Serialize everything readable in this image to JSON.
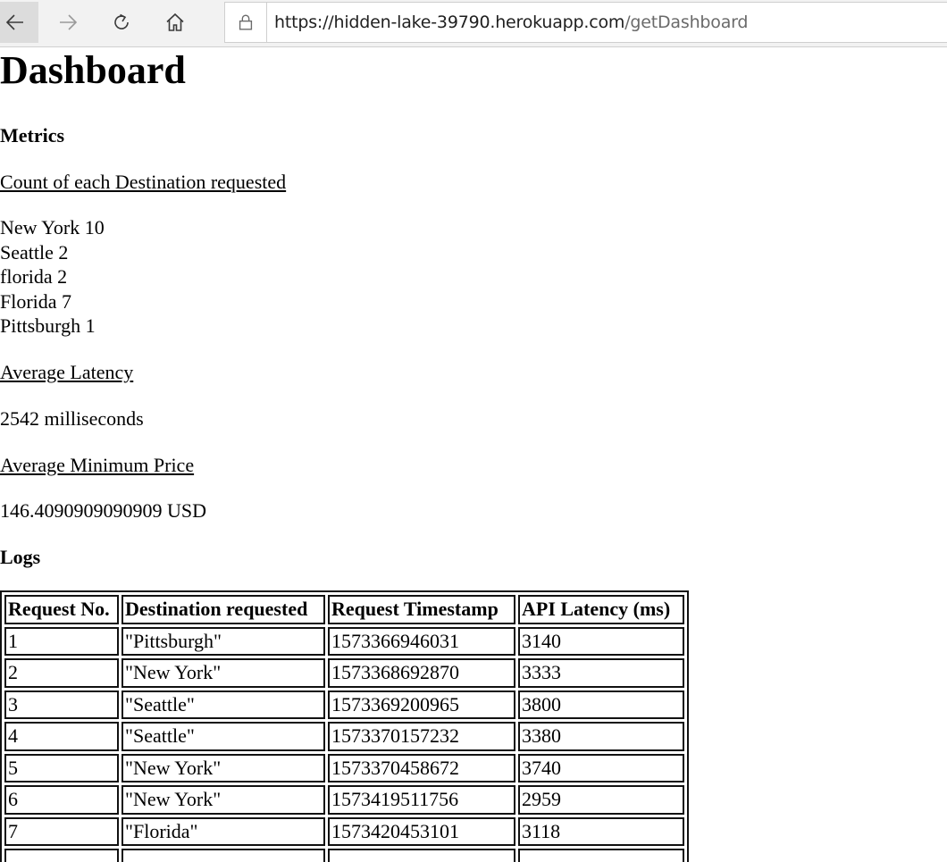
{
  "browser": {
    "url_host": "https://hidden-lake-39790.herokuapp.com",
    "url_path": "/getDashboard"
  },
  "page": {
    "title": "Dashboard",
    "metrics_heading": "Metrics",
    "destination_count_heading": "Count of each Destination requested",
    "destination_counts": [
      {
        "text": "New York 10"
      },
      {
        "text": "Seattle 2"
      },
      {
        "text": "florida 2"
      },
      {
        "text": "Florida 7"
      },
      {
        "text": "Pittsburgh 1"
      }
    ],
    "avg_latency_heading": "Average Latency",
    "avg_latency_value": "2542 milliseconds",
    "avg_min_price_heading": "Average Minimum Price",
    "avg_min_price_value": "146.4090909090909 USD",
    "logs_heading": "Logs"
  },
  "logs_table": {
    "headers": [
      "Request No.",
      "Destination requested",
      "Request Timestamp",
      "API Latency (ms)"
    ],
    "rows": [
      [
        "1",
        "\"Pittsburgh\"",
        "1573366946031",
        "3140"
      ],
      [
        "2",
        "\"New York\"",
        "1573368692870",
        "3333"
      ],
      [
        "3",
        "\"Seattle\"",
        "1573369200965",
        "3800"
      ],
      [
        "4",
        "\"Seattle\"",
        "1573370157232",
        "3380"
      ],
      [
        "5",
        "\"New York\"",
        "1573370458672",
        "3740"
      ],
      [
        "6",
        "\"New York\"",
        "1573419511756",
        "2959"
      ],
      [
        "7",
        "\"Florida\"",
        "1573420453101",
        "3118"
      ],
      [
        "",
        "",
        "",
        ""
      ]
    ]
  }
}
